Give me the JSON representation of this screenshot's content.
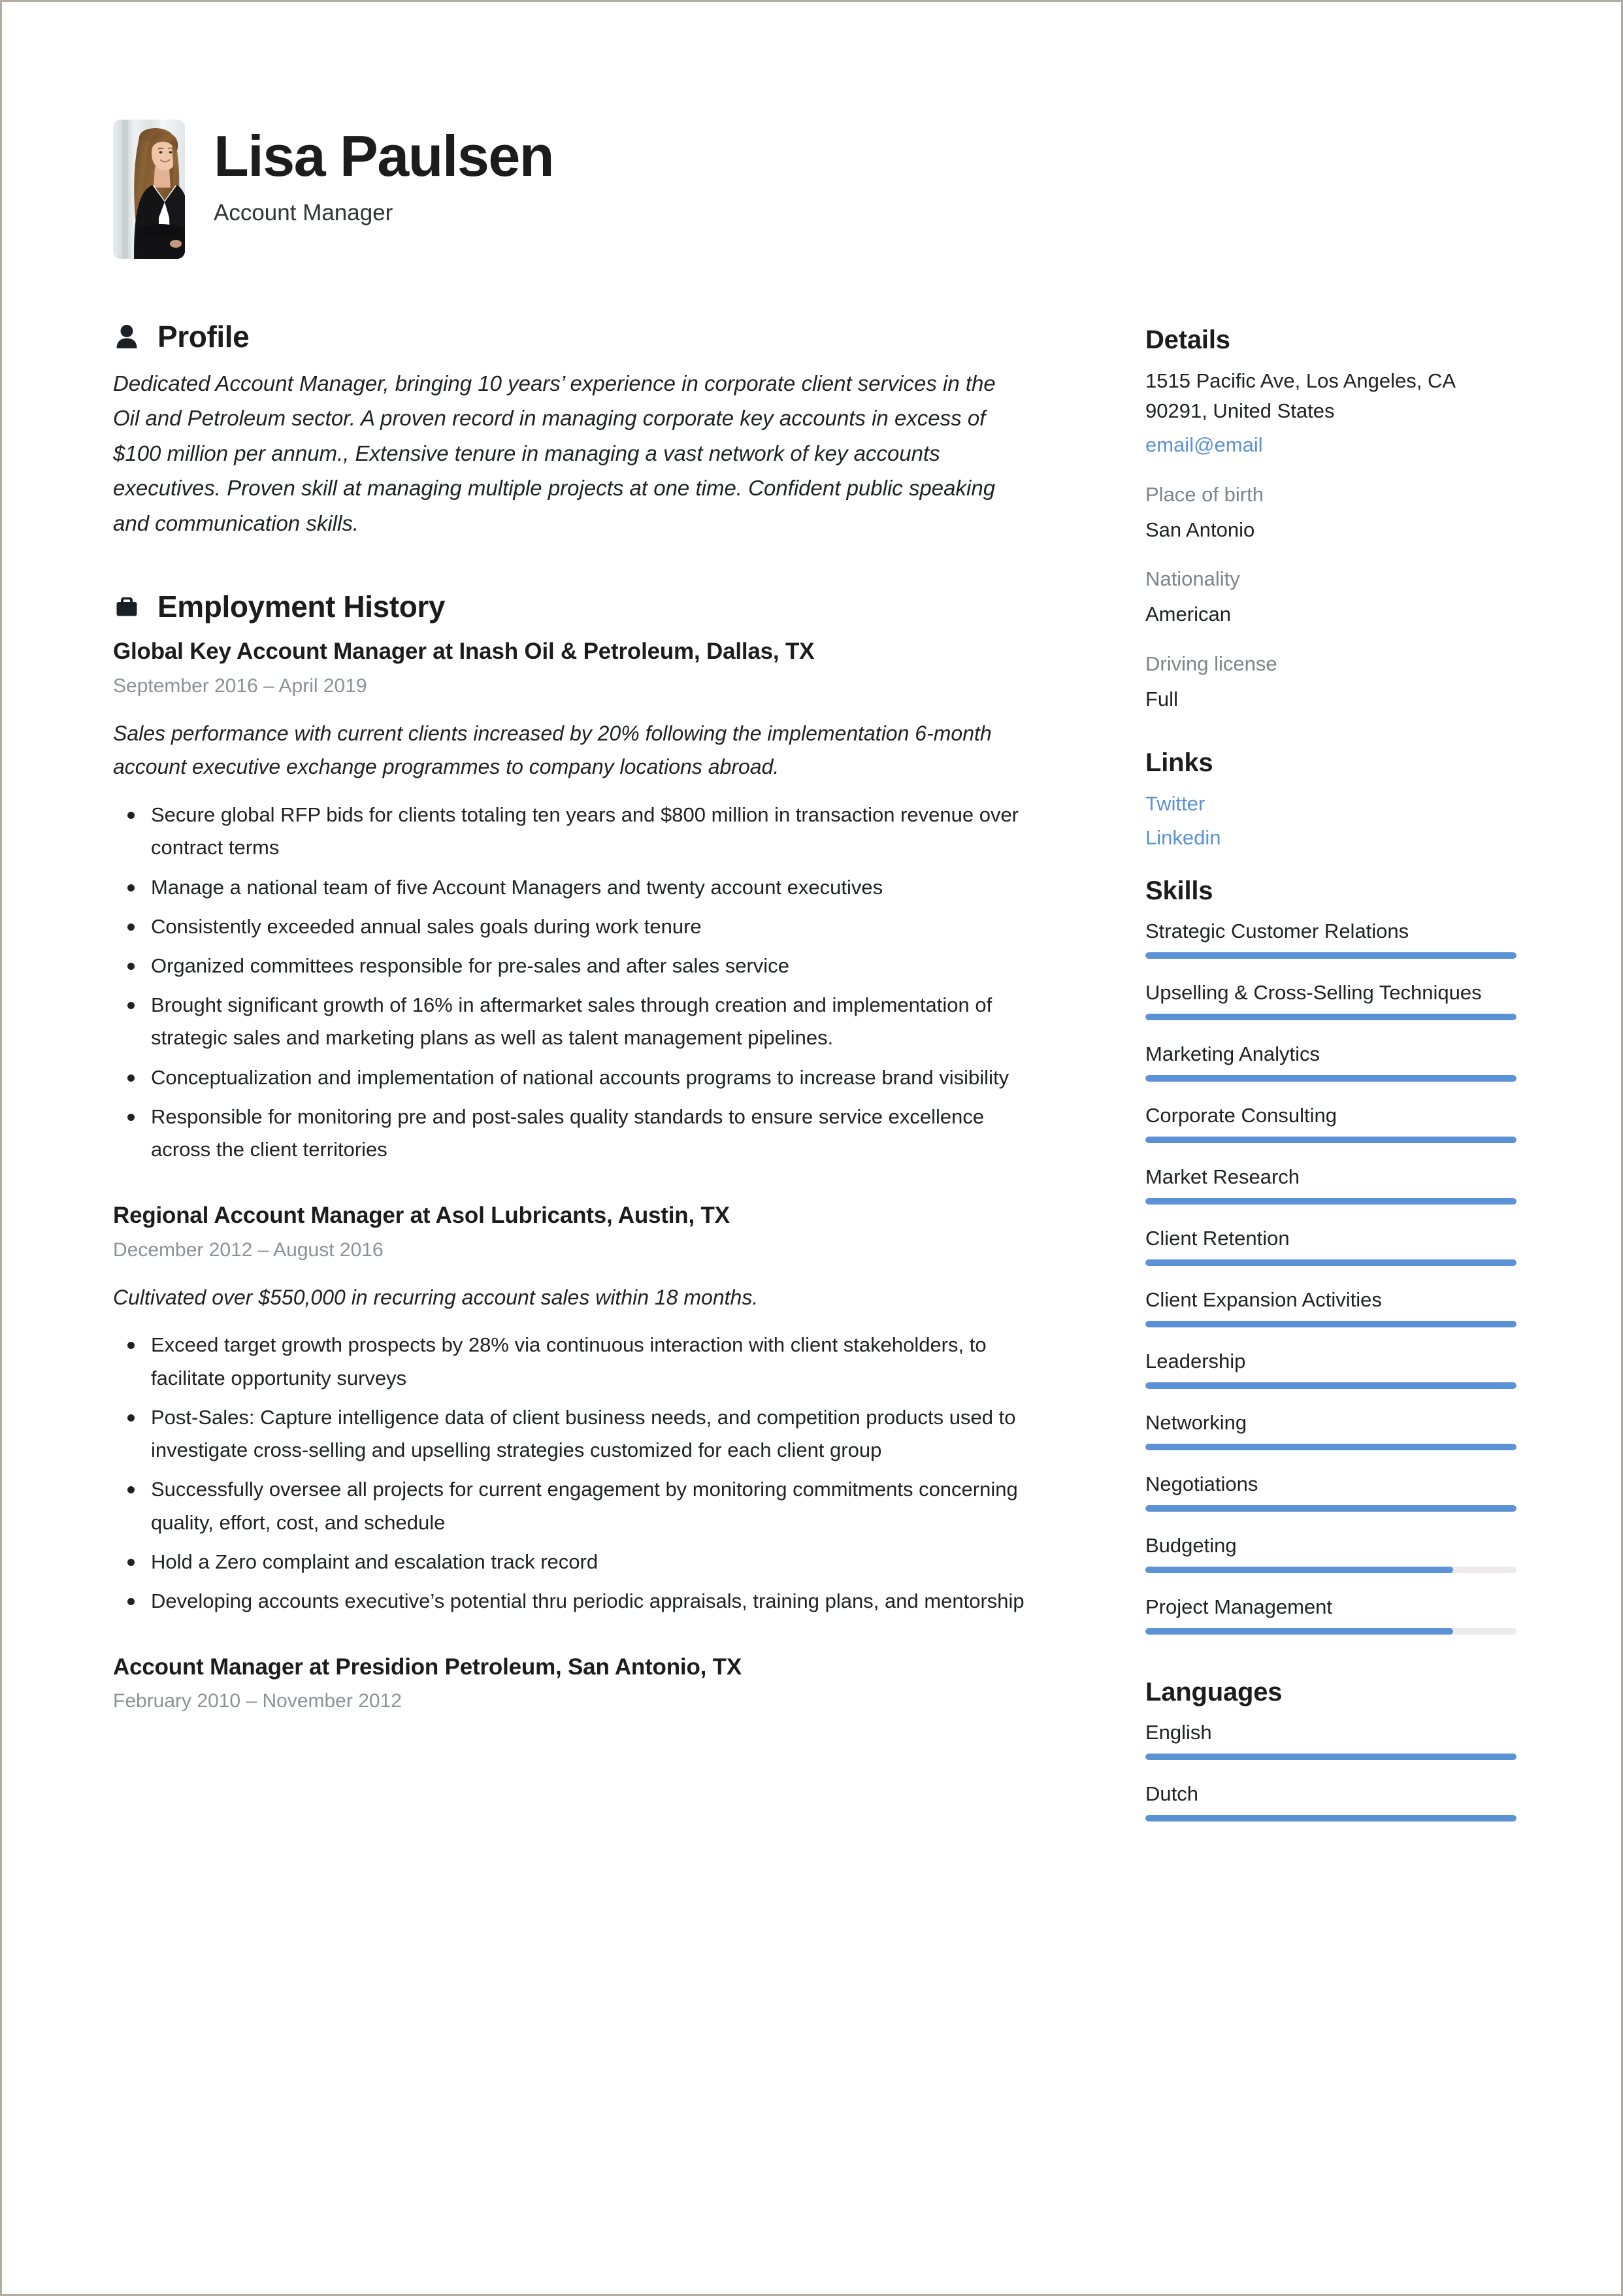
{
  "header": {
    "name": "Lisa Paulsen",
    "job_title": "Account Manager",
    "photo_alt": "portrait-photo"
  },
  "profile": {
    "section_title": "Profile",
    "icon": "person-icon",
    "text": "Dedicated Account Manager, bringing 10 years’ experience in corporate client services in the Oil and Petroleum sector.  A proven record in managing corporate key accounts in excess of $100 million per annum., Extensive tenure in managing a vast network of key accounts executives. Proven skill at managing multiple projects at one time. Confident public speaking and communication skills."
  },
  "employment": {
    "section_title": "Employment History",
    "icon": "briefcase-icon",
    "jobs": [
      {
        "heading": "Global Key Account Manager at Inash Oil & Petroleum, Dallas, TX",
        "dates": "September 2016  –  April 2019",
        "summary": "Sales performance with current clients increased by 20% following the implementation 6-month account executive exchange programmes to company locations abroad.",
        "bullets": [
          "Secure global RFP bids for clients totaling ten years and $800 million in transaction revenue over contract terms",
          "Manage a national team of five Account Managers and twenty account executives",
          "Consistently exceeded annual sales goals during work tenure",
          "Organized committees responsible for pre-sales and after sales service",
          "Brought significant growth of 16% in aftermarket sales through creation and implementation of strategic sales and marketing plans as well as talent management pipelines.",
          "Conceptualization and implementation of national accounts programs to increase brand visibility",
          "Responsible for monitoring pre and post-sales quality standards to ensure service excellence across the client territories"
        ]
      },
      {
        "heading": "Regional Account Manager at Asol Lubricants, Austin, TX",
        "dates": "December 2012  –  August 2016",
        "summary": "Cultivated over $550,000 in recurring account sales within 18 months.",
        "bullets": [
          "Exceed target growth prospects by 28% via continuous interaction with client stakeholders, to facilitate opportunity surveys",
          "Post-Sales: Capture intelligence data of client business needs, and competition products used to investigate cross-selling and upselling strategies customized for each client group",
          "Successfully oversee all projects for current engagement by monitoring commitments concerning quality, effort, cost, and schedule",
          "Hold a Zero complaint and escalation track record",
          "Developing accounts executive’s potential thru periodic appraisals, training plans, and mentorship"
        ]
      },
      {
        "heading": "Account Manager at Presidion Petroleum, San Antonio, TX",
        "dates": "February 2010  –  November 2012",
        "summary": "",
        "bullets": []
      }
    ]
  },
  "details": {
    "section_title": "Details",
    "address_line1": "1515 Pacific Ave, Los Angeles, CA",
    "address_line2": "90291, United States",
    "email": "email@email",
    "place_of_birth_label": "Place of birth",
    "place_of_birth_value": "San Antonio",
    "nationality_label": "Nationality",
    "nationality_value": "American",
    "driving_license_label": "Driving license",
    "driving_license_value": "Full"
  },
  "links": {
    "section_title": "Links",
    "items": [
      {
        "label": "Twitter"
      },
      {
        "label": "Linkedin"
      }
    ]
  },
  "skills": {
    "section_title": "Skills",
    "items": [
      {
        "name": "Strategic Customer Relations",
        "level": 100
      },
      {
        "name": "Upselling & Cross-Selling Techniques",
        "level": 100
      },
      {
        "name": "Marketing Analytics",
        "level": 100
      },
      {
        "name": "Corporate Consulting",
        "level": 100
      },
      {
        "name": "Market Research",
        "level": 100
      },
      {
        "name": "Client Retention",
        "level": 100
      },
      {
        "name": "Client Expansion Activities",
        "level": 100
      },
      {
        "name": "Leadership",
        "level": 100
      },
      {
        "name": "Networking",
        "level": 100
      },
      {
        "name": "Negotiations",
        "level": 100
      },
      {
        "name": "Budgeting",
        "level": 83
      },
      {
        "name": "Project Management",
        "level": 83
      }
    ]
  },
  "languages": {
    "section_title": "Languages",
    "items": [
      {
        "name": "English",
        "level": 100
      },
      {
        "name": "Dutch",
        "level": 100
      }
    ]
  },
  "colors": {
    "accent_blue": "#5b92d6",
    "track_gray": "#eceaea",
    "muted_text": "#7e848a",
    "body_text": "#1f2123"
  }
}
